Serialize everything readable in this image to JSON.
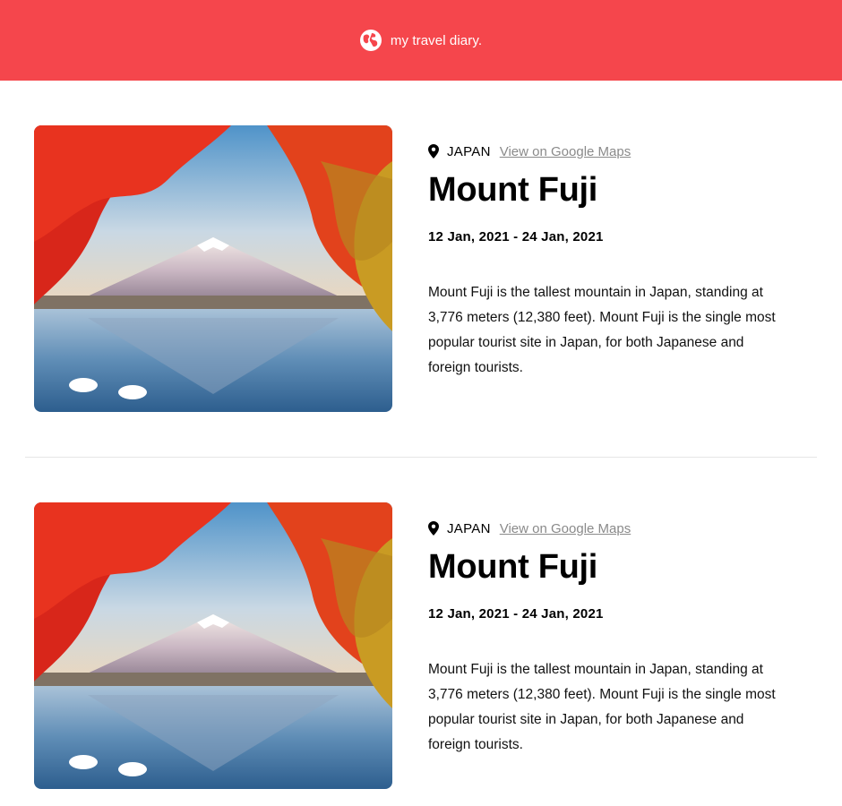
{
  "header": {
    "title": "my travel diary.",
    "icon": "globe-icon",
    "background": "#f5464c"
  },
  "entries": [
    {
      "image_icon": "mount-fuji-photo",
      "country": "JAPAN",
      "maps_link": "View on Google Maps",
      "title": "Mount Fuji",
      "dates": "12 Jan, 2021 - 24 Jan, 2021",
      "description": "Mount Fuji is the tallest mountain in Japan, standing at 3,776 meters (12,380 feet). Mount Fuji is the single most popular tourist site in Japan, for both Japanese and foreign tourists."
    },
    {
      "image_icon": "mount-fuji-photo",
      "country": "JAPAN",
      "maps_link": "View on Google Maps",
      "title": "Mount Fuji",
      "dates": "12 Jan, 2021 - 24 Jan, 2021",
      "description": "Mount Fuji is the tallest mountain in Japan, standing at 3,776 meters (12,380 feet). Mount Fuji is the single most popular tourist site in Japan, for both Japanese and foreign tourists."
    }
  ]
}
